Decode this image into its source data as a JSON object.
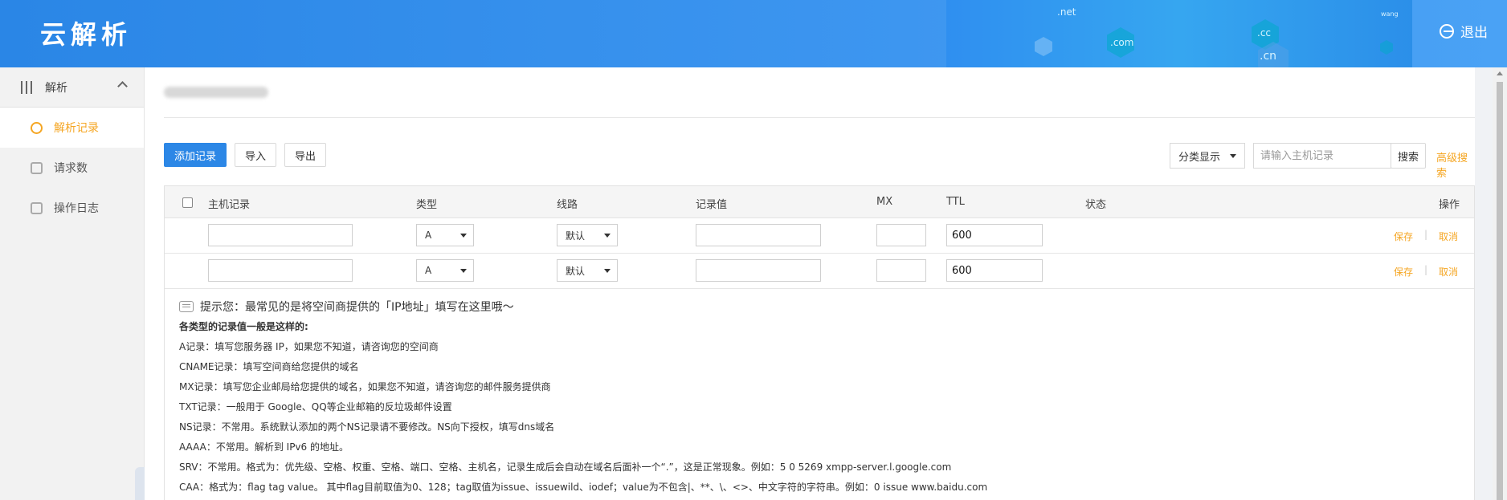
{
  "header": {
    "logo": "云解析",
    "logout_label": "退出",
    "deco_domains": [
      ".net",
      ".com",
      ".cc",
      ".cn",
      "wang"
    ]
  },
  "sidebar": {
    "group_label": "解析",
    "items": [
      {
        "label": "解析记录",
        "active": true
      },
      {
        "label": "请求数",
        "active": false
      },
      {
        "label": "操作日志",
        "active": false
      }
    ]
  },
  "toolbar": {
    "add_label": "添加记录",
    "import_label": "导入",
    "export_label": "导出",
    "view_select": "分类显示",
    "search_placeholder": "请输入主机记录",
    "search_button": "搜索",
    "advanced_search": "高级搜索"
  },
  "table": {
    "headers": {
      "host": "主机记录",
      "type": "类型",
      "line": "线路",
      "value": "记录值",
      "mx": "MX",
      "ttl": "TTL",
      "status": "状态",
      "ops": "操作"
    },
    "rows": [
      {
        "host": "",
        "type": "A",
        "line": "默认",
        "value": "",
        "mx": "",
        "ttl": "600",
        "save": "保存",
        "cancel": "取消"
      },
      {
        "host": "",
        "type": "A",
        "line": "默认",
        "value": "",
        "mx": "",
        "ttl": "600",
        "save": "保存",
        "cancel": "取消"
      }
    ]
  },
  "tips": {
    "title": "提示您：最常见的是将空间商提供的「IP地址」填写在这里哦～",
    "subtitle": "各类型的记录值一般是这样的:",
    "lines": [
      "A记录：填写您服务器 IP，如果您不知道，请咨询您的空间商",
      "CNAME记录：填写空间商给您提供的域名",
      "MX记录：填写您企业邮局给您提供的域名，如果您不知道，请咨询您的邮件服务提供商",
      "TXT记录：一般用于 Google、QQ等企业邮箱的反垃圾邮件设置",
      "NS记录：不常用。系统默认添加的两个NS记录请不要修改。NS向下授权，填写dns域名",
      "AAAA：不常用。解析到 IPv6 的地址。",
      "SRV：不常用。格式为：优先级、空格、权重、空格、端口、空格、主机名，记录生成后会自动在域名后面补一个“.”，这是正常现象。例如：5 0 5269 xmpp-server.l.google.com",
      "CAA：格式为：flag tag value。 其中flag目前取值为0、128；tag取值为issue、issuewild、iodef；value为不包含|、**、\\、<>、中文字符的字符串。例如：0 issue www.baidu.com"
    ]
  }
}
